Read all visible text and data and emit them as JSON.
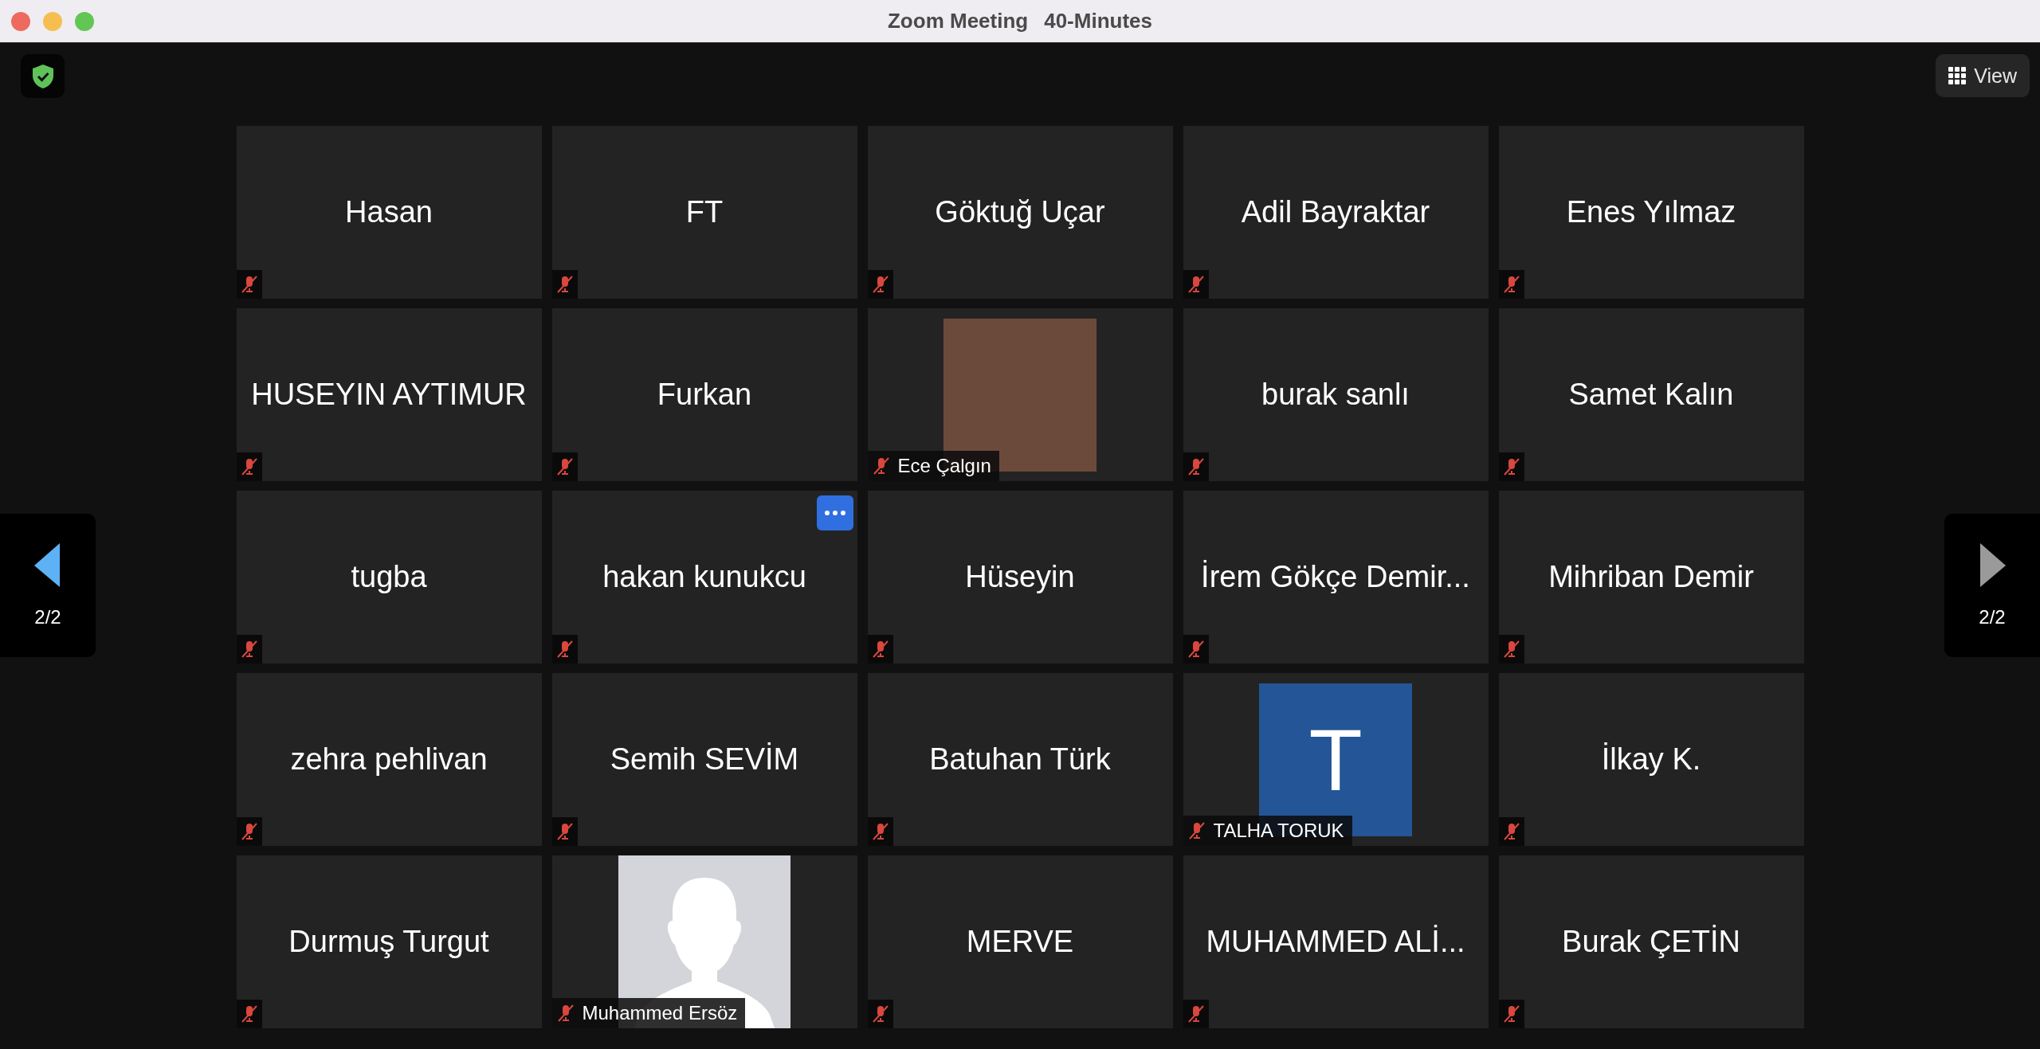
{
  "window": {
    "title": "Zoom Meeting",
    "subtitle": "40-Minutes"
  },
  "toolbar": {
    "view_button": "View"
  },
  "pager": {
    "previous": "2/2",
    "next": "2/2"
  },
  "tiles": [
    {
      "kind": "name",
      "name": "Hasan",
      "muted": true,
      "more_button": false
    },
    {
      "kind": "name",
      "name": "FT",
      "muted": true,
      "more_button": false
    },
    {
      "kind": "name",
      "name": "Göktuğ Uçar",
      "muted": true,
      "more_button": false
    },
    {
      "kind": "name",
      "name": "Adil Bayraktar",
      "muted": true,
      "more_button": false
    },
    {
      "kind": "name",
      "name": "Enes Yılmaz",
      "muted": true,
      "more_button": false
    },
    {
      "kind": "name",
      "name": "HUSEYIN AYTIMUR",
      "muted": true,
      "more_button": false
    },
    {
      "kind": "name",
      "name": "Furkan",
      "muted": true,
      "more_button": false
    },
    {
      "kind": "photo",
      "name": "Ece Çalgın",
      "muted": true,
      "more_button": false
    },
    {
      "kind": "name",
      "name": "burak sanlı",
      "muted": true,
      "more_button": false
    },
    {
      "kind": "name",
      "name": "Samet Kalın",
      "muted": true,
      "more_button": false
    },
    {
      "kind": "name",
      "name": "tugba",
      "muted": true,
      "more_button": false
    },
    {
      "kind": "name",
      "name": "hakan kunukcu",
      "muted": true,
      "more_button": true
    },
    {
      "kind": "name",
      "name": "Hüseyin",
      "muted": true,
      "more_button": false
    },
    {
      "kind": "name",
      "name": "İrem Gökçe Demir...",
      "muted": true,
      "more_button": false
    },
    {
      "kind": "name",
      "name": "Mihriban Demir",
      "muted": true,
      "more_button": false
    },
    {
      "kind": "name",
      "name": "zehra pehlivan",
      "muted": true,
      "more_button": false
    },
    {
      "kind": "name",
      "name": "Semih SEVİM",
      "muted": true,
      "more_button": false
    },
    {
      "kind": "name",
      "name": "Batuhan Türk",
      "muted": true,
      "more_button": false
    },
    {
      "kind": "initial",
      "name": "TALHA TORUK",
      "initial": "T",
      "muted": true,
      "more_button": false
    },
    {
      "kind": "name",
      "name": "İlkay K.",
      "muted": true,
      "more_button": false
    },
    {
      "kind": "name",
      "name": "Durmuş Turgut",
      "muted": true,
      "more_button": false
    },
    {
      "kind": "silhouette",
      "name": "Muhammed Ersöz",
      "muted": true,
      "more_button": false
    },
    {
      "kind": "name",
      "name": "MERVE",
      "muted": true,
      "more_button": false
    },
    {
      "kind": "name",
      "name": "MUHAMMED ALİ...",
      "muted": true,
      "more_button": false
    },
    {
      "kind": "name",
      "name": "Burak ÇETİN",
      "muted": true,
      "more_button": false
    }
  ]
}
